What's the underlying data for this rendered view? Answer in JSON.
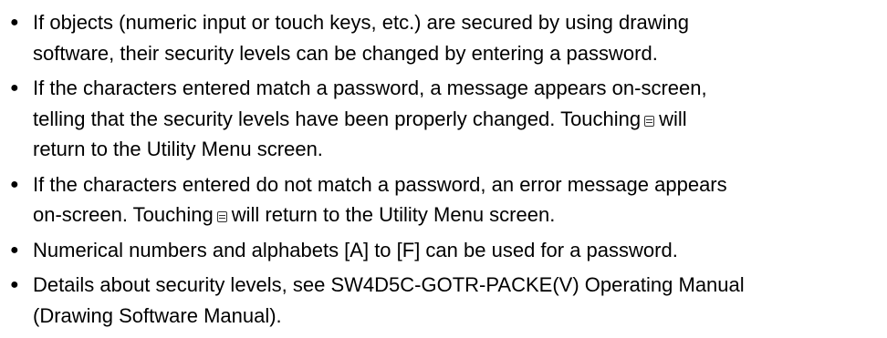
{
  "notes": [
    {
      "lines": [
        "If objects (numeric input or touch keys, etc.) are secured by using drawing",
        "software, their security levels can be changed by entering a password."
      ]
    },
    {
      "lines": [
        "If the characters entered match a password, a message appears on-screen,",
        "return to the Utility Menu screen."
      ],
      "icon_line": {
        "before": "telling that the security levels have been properly changed. Touching",
        "icon": "key-icon",
        "after": "will"
      }
    },
    {
      "lines": [
        "If the characters entered do not match a password, an error message appears"
      ],
      "icon_line": {
        "before": "on-screen. Touching",
        "icon": "key-icon",
        "after": "will return to the Utility Menu screen."
      }
    },
    {
      "lines": [
        "Numerical numbers and alphabets [A] to [F] can be used for a password."
      ]
    },
    {
      "lines": [
        "Details about security levels, see SW4D5C-GOTR-PACKE(V) Operating Manual",
        "(Drawing Software Manual)."
      ]
    }
  ]
}
